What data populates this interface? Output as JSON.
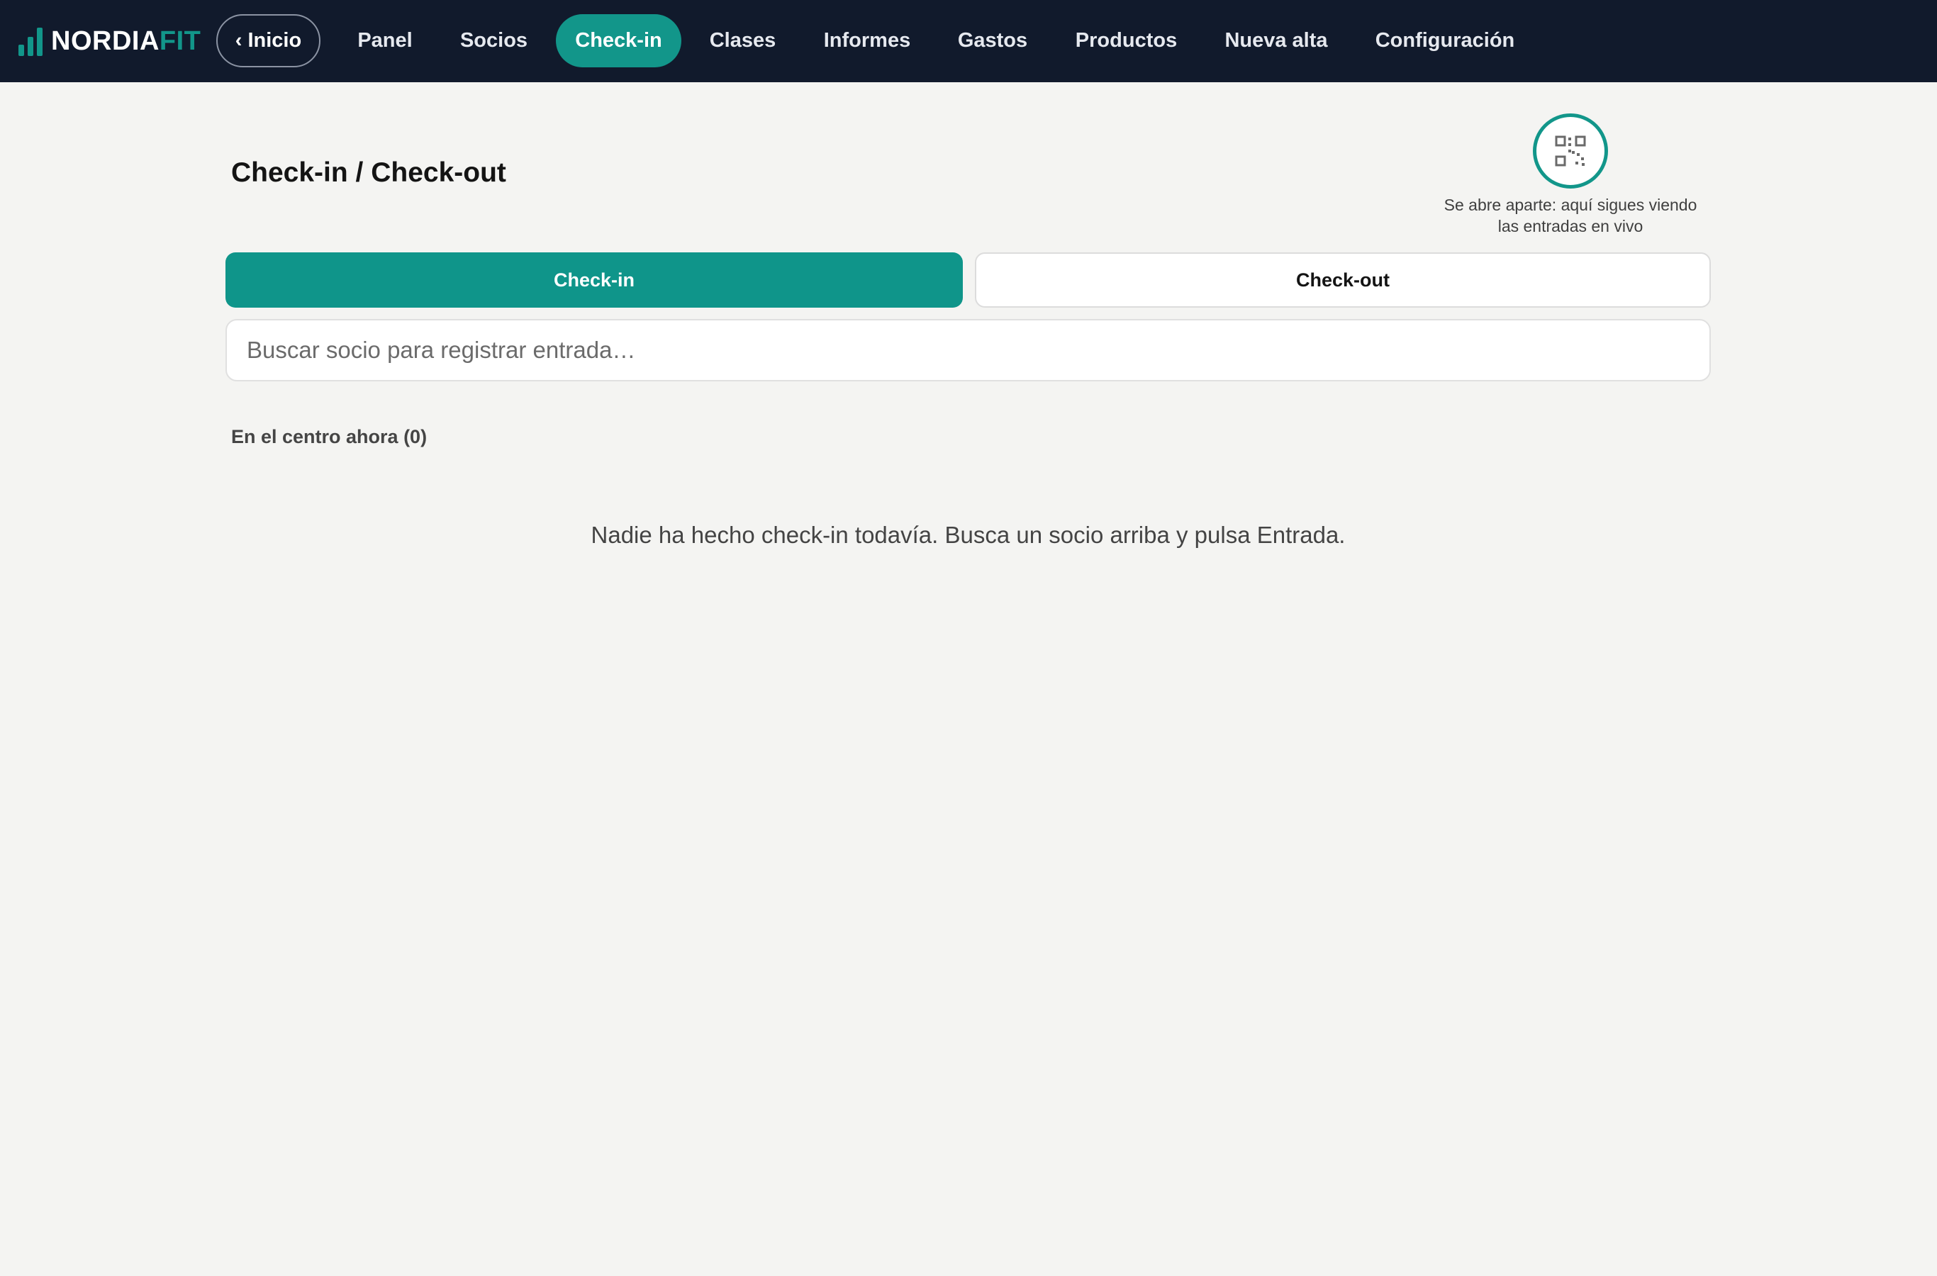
{
  "brand": {
    "name_part1": "NORDIA",
    "name_part2": "FIT"
  },
  "nav": {
    "back_label": "Inicio",
    "items": [
      {
        "label": "Panel"
      },
      {
        "label": "Socios"
      },
      {
        "label": "Check-in"
      },
      {
        "label": "Clases"
      },
      {
        "label": "Informes"
      },
      {
        "label": "Gastos"
      },
      {
        "label": "Productos"
      },
      {
        "label": "Nueva alta"
      },
      {
        "label": "Configuración"
      }
    ],
    "active": "Check-in"
  },
  "main": {
    "title": "Check-in / Check-out",
    "qr": {
      "icon": "qr-code-icon",
      "caption_line1": "Se abre aparte: aquí sigues viendo",
      "caption_line2": "las entradas en vivo"
    },
    "tabs": [
      {
        "label": "Check-in",
        "active": true
      },
      {
        "label": "Check-out",
        "active": false
      }
    ],
    "search": {
      "placeholder": "Buscar socio para registrar entrada…",
      "value": ""
    },
    "present_label": "En el centro ahora (0)",
    "empty_message": "Nadie ha hecho check-in todavía. Busca un socio arriba y pulsa Entrada."
  },
  "colors": {
    "topbar": "#111a2c",
    "accent": "#12968a",
    "background": "#f4f4f2"
  }
}
